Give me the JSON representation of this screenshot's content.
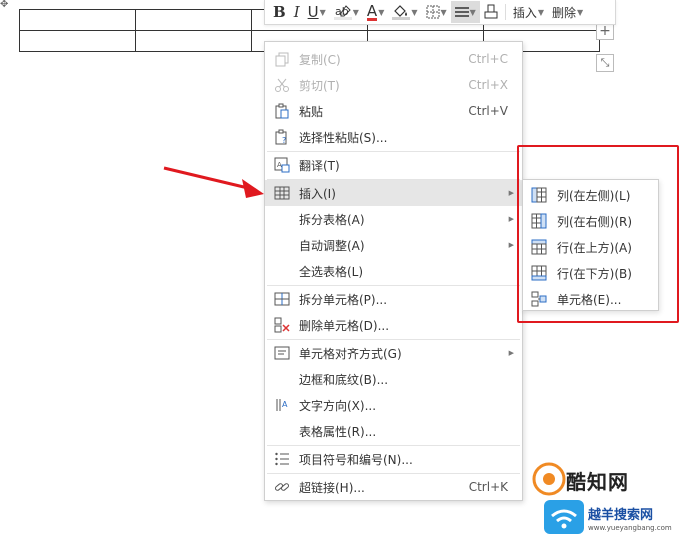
{
  "toolbar": {
    "bold": "B",
    "italic": "I",
    "underline": "U",
    "font_color": "A",
    "insert_label": "插入",
    "delete_label": "删除"
  },
  "context_menu": {
    "items": [
      {
        "label": "复制(C)",
        "shortcut": "Ctrl+C",
        "icon": "copy-icon",
        "disabled": true
      },
      {
        "label": "剪切(T)",
        "shortcut": "Ctrl+X",
        "icon": "scissors-icon",
        "disabled": true
      },
      {
        "label": "粘贴",
        "shortcut": "Ctrl+V",
        "icon": "paste-icon"
      },
      {
        "label": "选择性粘贴(S)...",
        "icon": "paste-special-icon"
      },
      {
        "label": "翻译(T)",
        "icon": "translate-icon"
      },
      {
        "label": "插入(I)",
        "icon": "table-insert-icon",
        "submenu": true,
        "hover": true
      },
      {
        "label": "拆分表格(A)",
        "submenu": true
      },
      {
        "label": "自动调整(A)",
        "submenu": true
      },
      {
        "label": "全选表格(L)"
      },
      {
        "label": "拆分单元格(P)...",
        "icon": "split-cells-icon"
      },
      {
        "label": "删除单元格(D)...",
        "icon": "delete-cells-icon"
      },
      {
        "label": "单元格对齐方式(G)",
        "icon": "cell-align-icon",
        "submenu": true
      },
      {
        "label": "边框和底纹(B)..."
      },
      {
        "label": "文字方向(X)...",
        "icon": "text-direction-icon"
      },
      {
        "label": "表格属性(R)..."
      },
      {
        "label": "项目符号和编号(N)...",
        "icon": "bullet-list-icon"
      },
      {
        "label": "超链接(H)...",
        "shortcut": "Ctrl+K",
        "icon": "hyperlink-icon"
      }
    ]
  },
  "submenu": {
    "items": [
      {
        "label": "列(在左侧)(L)",
        "icon": "insert-column-left-icon"
      },
      {
        "label": "列(在右侧)(R)",
        "icon": "insert-column-right-icon"
      },
      {
        "label": "行(在上方)(A)",
        "icon": "insert-row-above-icon"
      },
      {
        "label": "行(在下方)(B)",
        "icon": "insert-row-below-icon"
      },
      {
        "label": "单元格(E)...",
        "icon": "insert-cell-icon"
      }
    ]
  },
  "watermark": {
    "title": "酷知网",
    "subtitle": "越羊搜索网",
    "url": "www.yueyangbang.com"
  },
  "colors": {
    "annotation_red": "#e0191f",
    "hover_bg": "#e6e6e6",
    "font_color_bar": "#dd3333"
  }
}
